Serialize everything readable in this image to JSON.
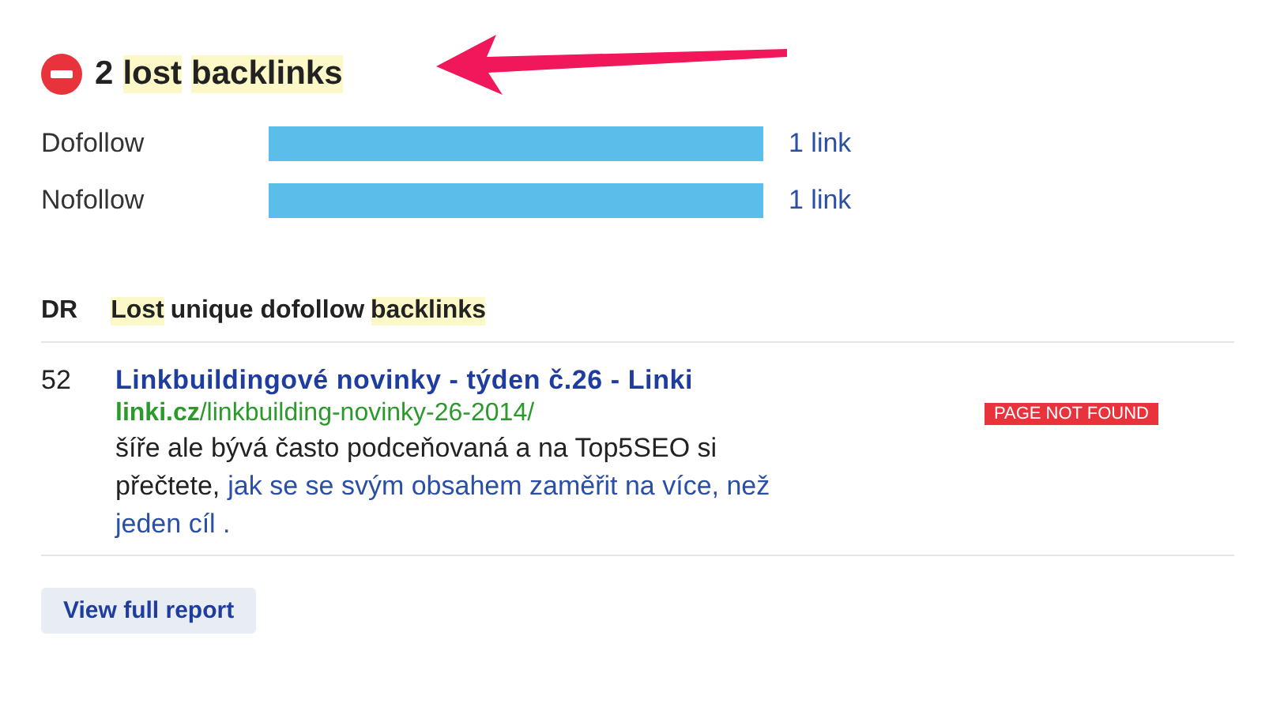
{
  "heading": {
    "segments": [
      {
        "text": "2",
        "highlighted": false
      },
      {
        "text": "lost",
        "highlighted": true
      },
      {
        "text": "backlinks",
        "highlighted": true
      }
    ]
  },
  "link_types": [
    {
      "label": "Dofollow",
      "level": 1,
      "count": "1 link"
    },
    {
      "label": "Nofollow",
      "level": 1,
      "count": "1 link"
    }
  ],
  "table": {
    "columns": [
      {
        "segments": [
          {
            "text": "DR",
            "highlighted": false
          }
        ]
      },
      {
        "segments": [
          {
            "text": "Lost",
            "highlighted": true
          },
          {
            "text": "unique dofollow",
            "highlighted": false
          },
          {
            "text": "backlinks",
            "highlighted": true
          }
        ]
      }
    ],
    "rows": [
      {
        "dr": "52",
        "title": "Linkbuildingové novinky - týden č.26 - Linki",
        "url_domain": "linki.cz",
        "url_path": "/linkbuilding-novinky-26-2014/",
        "snippet_lines": [
          {
            "text": "šíře ale bývá často podceňovaná a na Top5SEO si"
          },
          {
            "text": "přečtete,",
            "anchor": "jak se se svým obsahem zaměřit na více, než"
          },
          {
            "anchor": "jeden cíl ."
          }
        ],
        "badge": "PAGE NOT FOUND"
      }
    ]
  },
  "button": "View full report"
}
